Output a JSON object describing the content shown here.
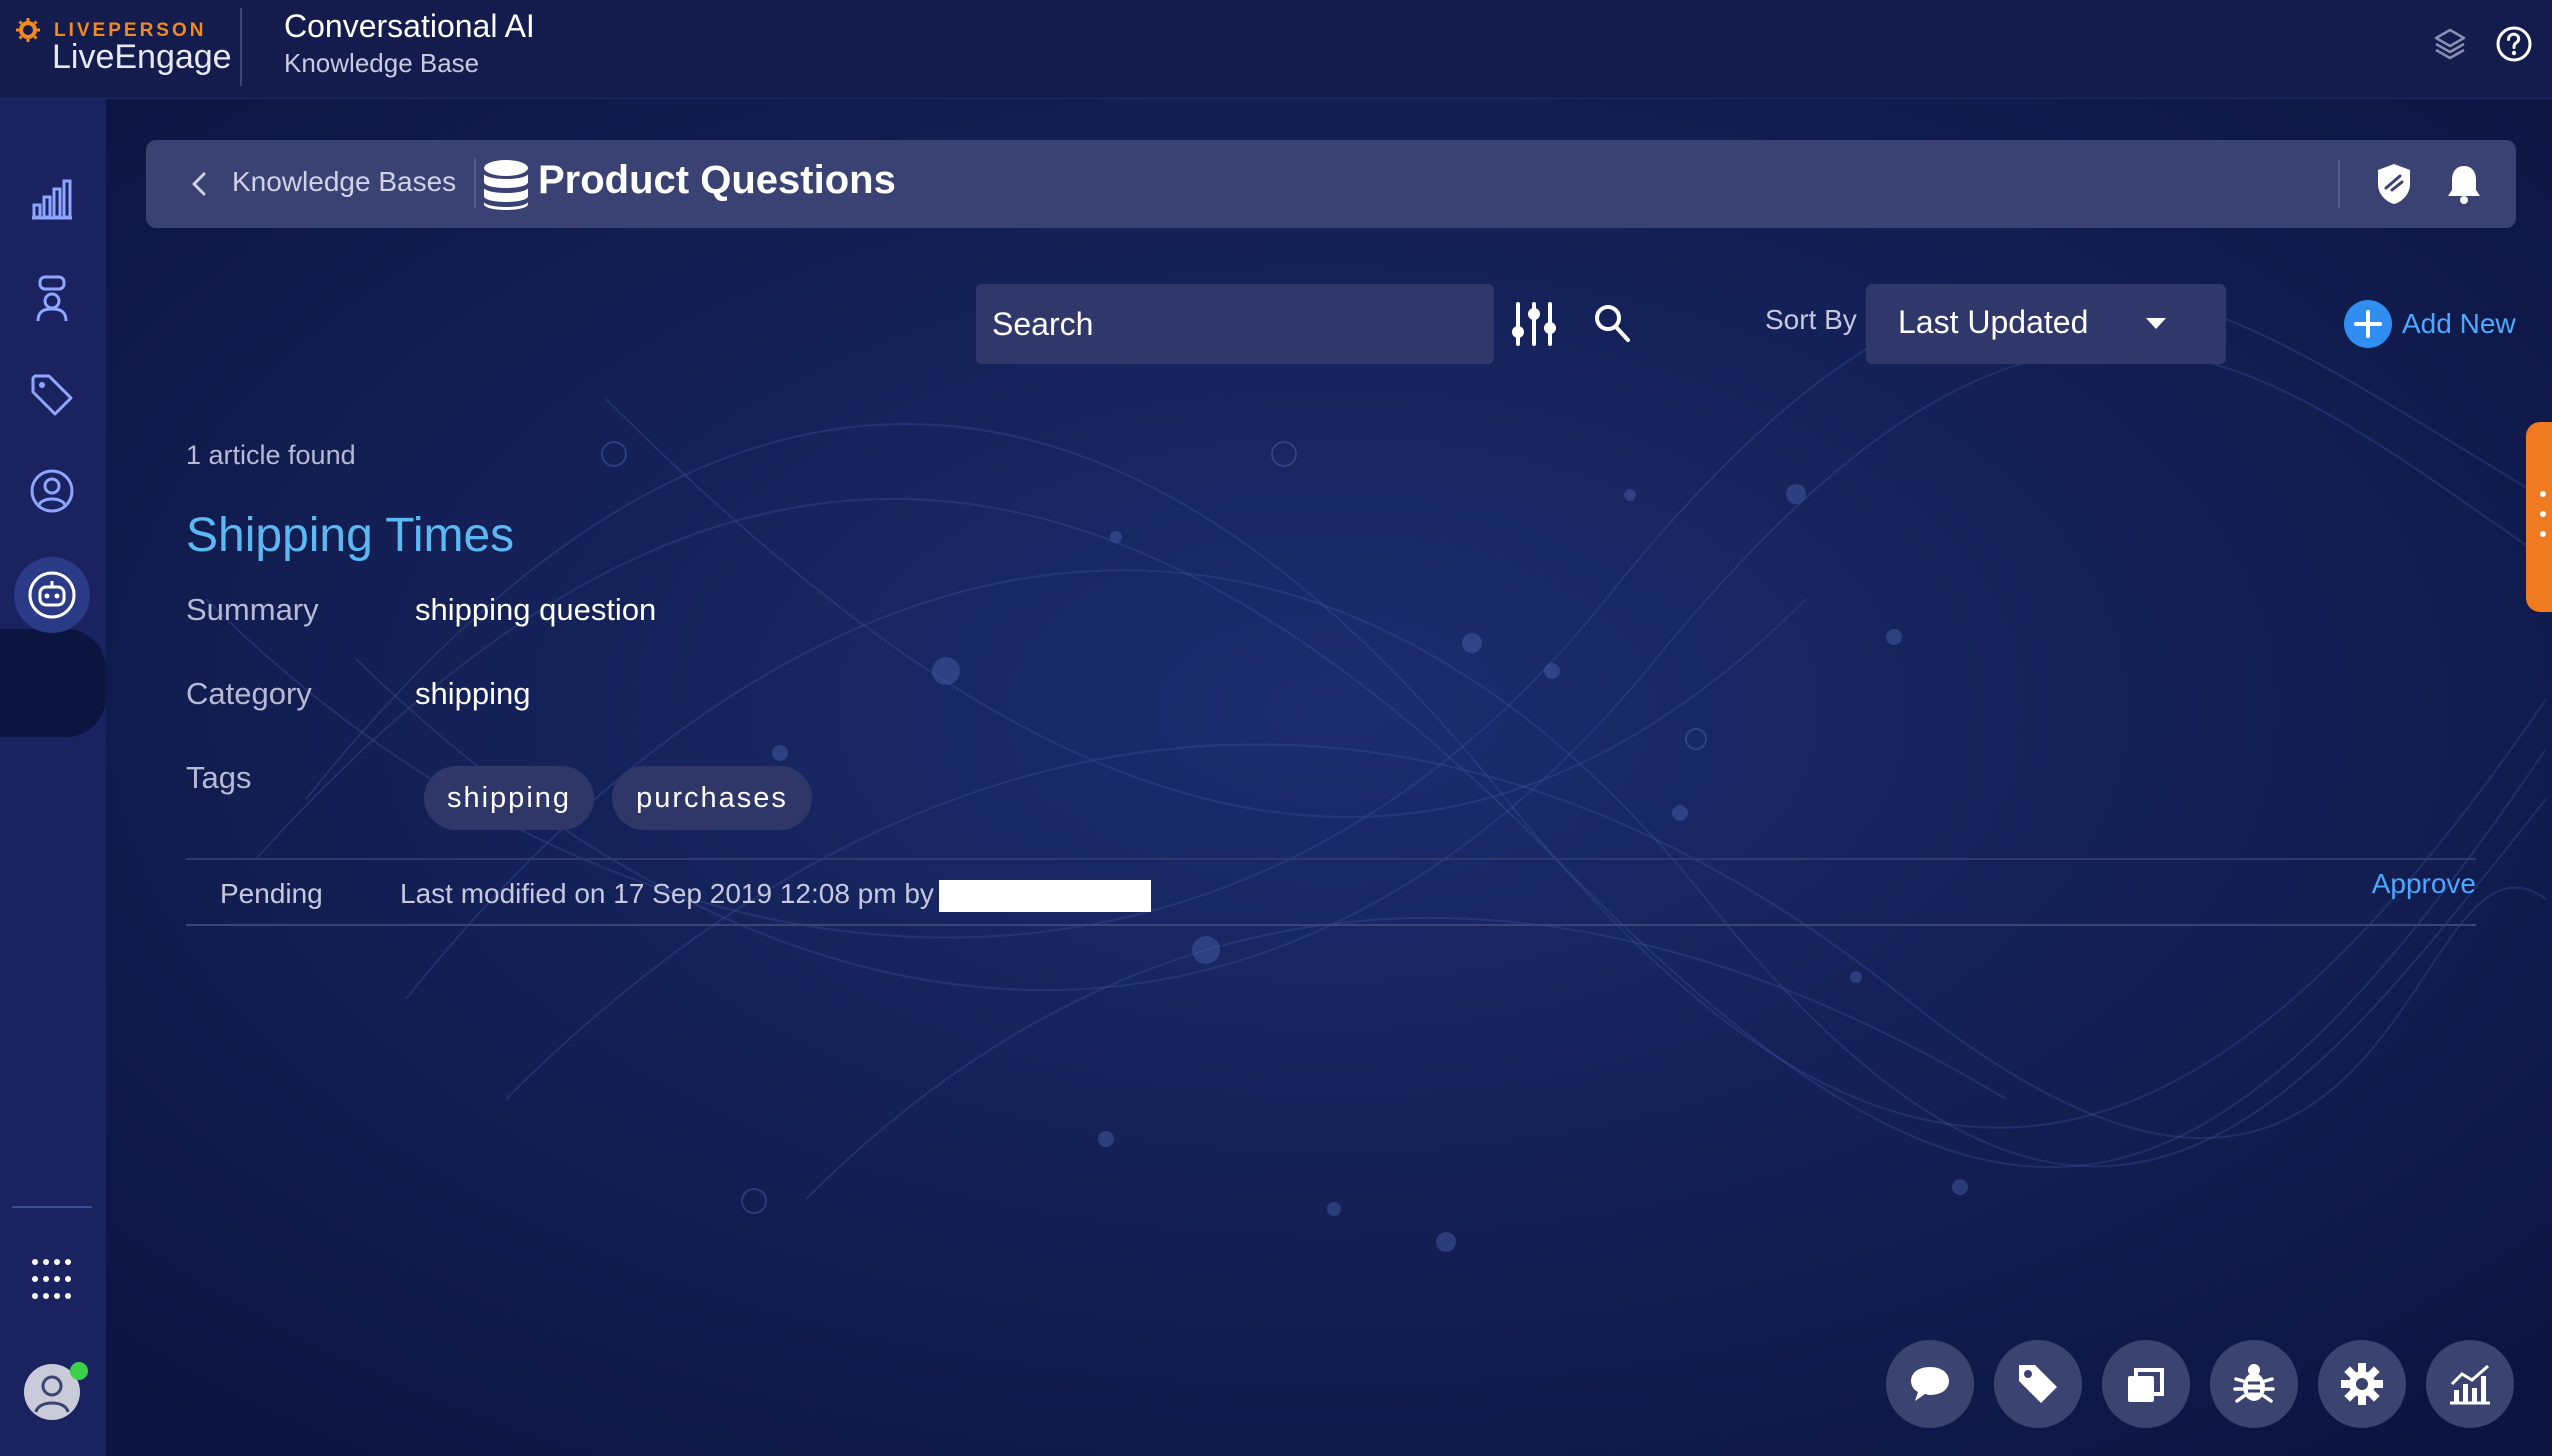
{
  "brand": {
    "company": "LIVEPERSON",
    "product": "LiveEngage"
  },
  "app": {
    "title": "Conversational AI",
    "subtitle": "Knowledge Base"
  },
  "header": {
    "breadcrumb": "Knowledge Bases",
    "title": "Product Questions"
  },
  "toolbar": {
    "search_placeholder": "Search",
    "sort_label": "Sort By",
    "sort_value": "Last Updated",
    "add_new_label": "Add New"
  },
  "results": {
    "count_text": "1 article found"
  },
  "article": {
    "title": "Shipping Times",
    "fields": [
      {
        "label": "Summary",
        "value": "shipping question"
      },
      {
        "label": "Category",
        "value": "shipping"
      }
    ],
    "tags_label": "Tags",
    "tags": [
      "shipping",
      "purchases"
    ],
    "status": "Pending",
    "modified": "Last modified on 17 Sep 2019 12:08 pm by",
    "approve_label": "Approve"
  },
  "icons": {
    "top_right": [
      "layers-icon",
      "help-icon"
    ],
    "header_right": [
      "shield-icon",
      "bell-icon"
    ],
    "sidebar": [
      "analytics-icon",
      "agent-icon",
      "tag-icon",
      "user-icon",
      "bot-icon"
    ],
    "dock": [
      "chat-icon",
      "tag-icon",
      "copy-icon",
      "bug-icon",
      "settings-icon",
      "analytics-icon"
    ]
  },
  "colors": {
    "background": "#0c1440",
    "sidebar": "#1a2260",
    "accent_link": "#4ea8ff",
    "article_title": "#5cb8f2",
    "brand_orange": "#f28a1c",
    "side_tab": "#f07a20",
    "presence": "#3ad04a"
  }
}
